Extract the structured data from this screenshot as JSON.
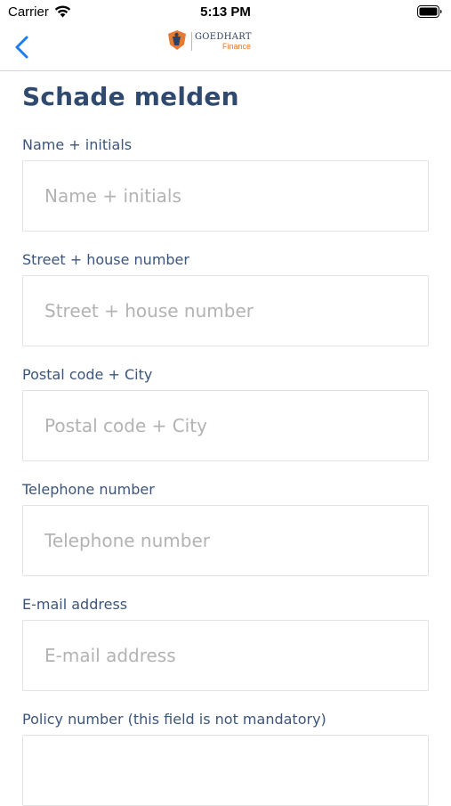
{
  "status_bar": {
    "carrier": "Carrier",
    "time": "5:13 PM"
  },
  "nav": {
    "back_icon": "chevron-left-icon",
    "accent_color": "#1a7ef2",
    "logo": {
      "name": "GOEDHART",
      "subtitle": "Finance",
      "brand_color": "#e67a30",
      "text_color": "#2f4162"
    }
  },
  "form": {
    "title": "Schade melden",
    "fields": [
      {
        "label": "Name + initials",
        "placeholder": "Name + initials",
        "value": ""
      },
      {
        "label": "Street + house number",
        "placeholder": "Street + house number",
        "value": ""
      },
      {
        "label": "Postal code + City",
        "placeholder": "Postal code + City",
        "value": ""
      },
      {
        "label": "Telephone number",
        "placeholder": "Telephone number",
        "value": ""
      },
      {
        "label": "E-mail address",
        "placeholder": "E-mail address",
        "value": ""
      },
      {
        "label": "Policy number (this field is not mandatory)",
        "placeholder": "",
        "value": ""
      }
    ]
  }
}
